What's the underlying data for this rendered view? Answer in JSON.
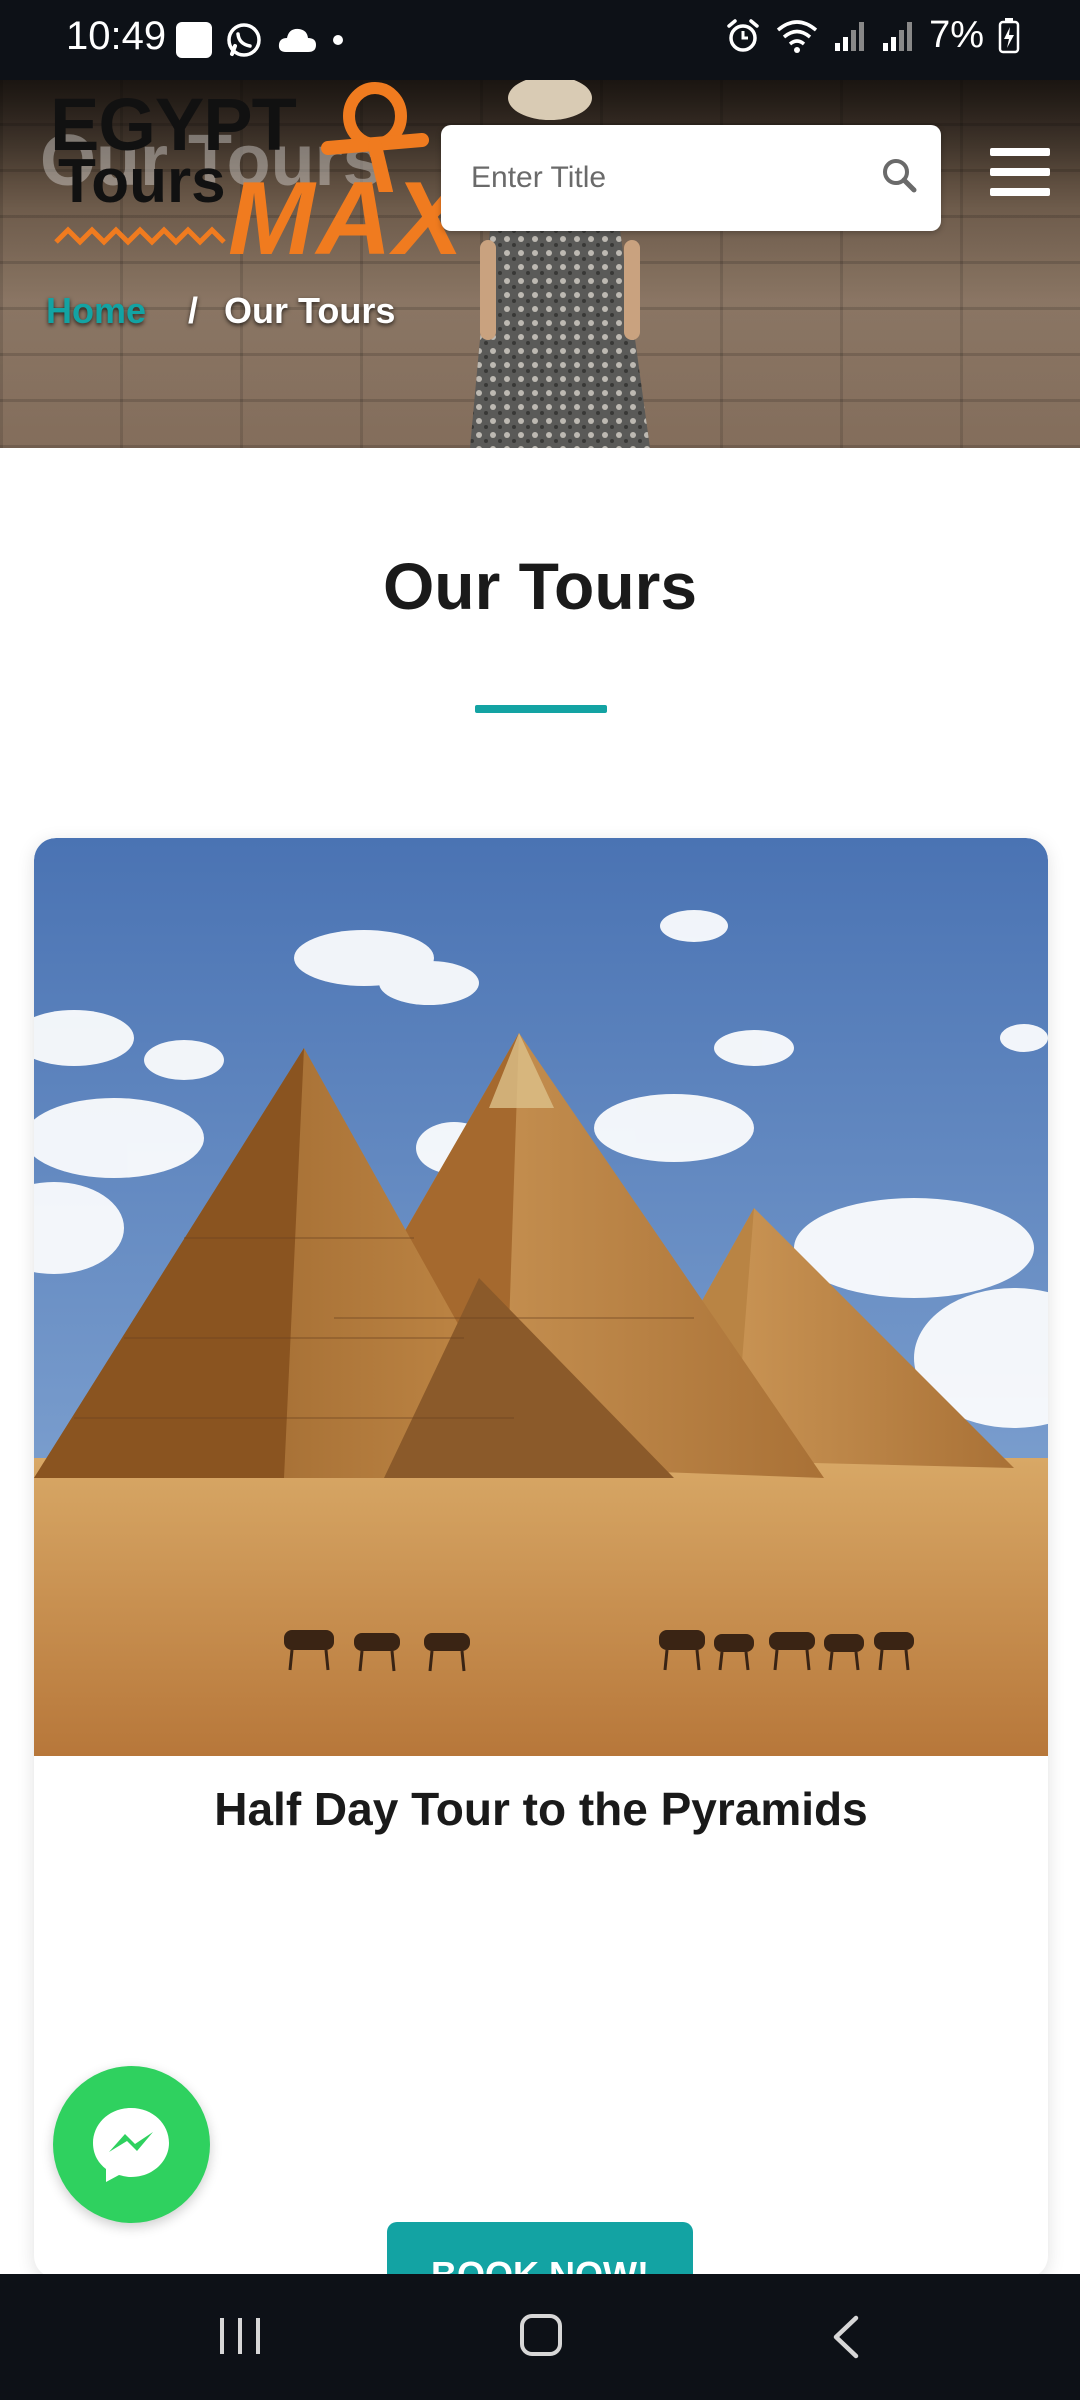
{
  "status_bar": {
    "time": "10:49",
    "battery": "7%",
    "left_icons": [
      "square-app-icon",
      "whatsapp-icon",
      "cloud-icon",
      "dot-icon"
    ],
    "right_icons": [
      "alarm-icon",
      "wifi-icon",
      "signal-icon",
      "signal-icon",
      "battery-charging-icon"
    ]
  },
  "header": {
    "logo": {
      "line1": "EGYPT",
      "line2": "Tours",
      "accent": "MAX"
    },
    "hero_heading": "Our Tours",
    "search": {
      "placeholder": "Enter Title"
    },
    "breadcrumb": {
      "home": "Home",
      "separator": "/",
      "current": "Our Tours"
    }
  },
  "section": {
    "title": "Our Tours"
  },
  "tour_card": {
    "title": "Half Day Tour to the Pyramids",
    "button_label": "BOOK NOW!"
  },
  "colors": {
    "accent_teal": "#13a3a3",
    "logo_orange": "#f07b1f",
    "messenger_green": "#2fd15f",
    "system_bar": "#0d1117"
  }
}
